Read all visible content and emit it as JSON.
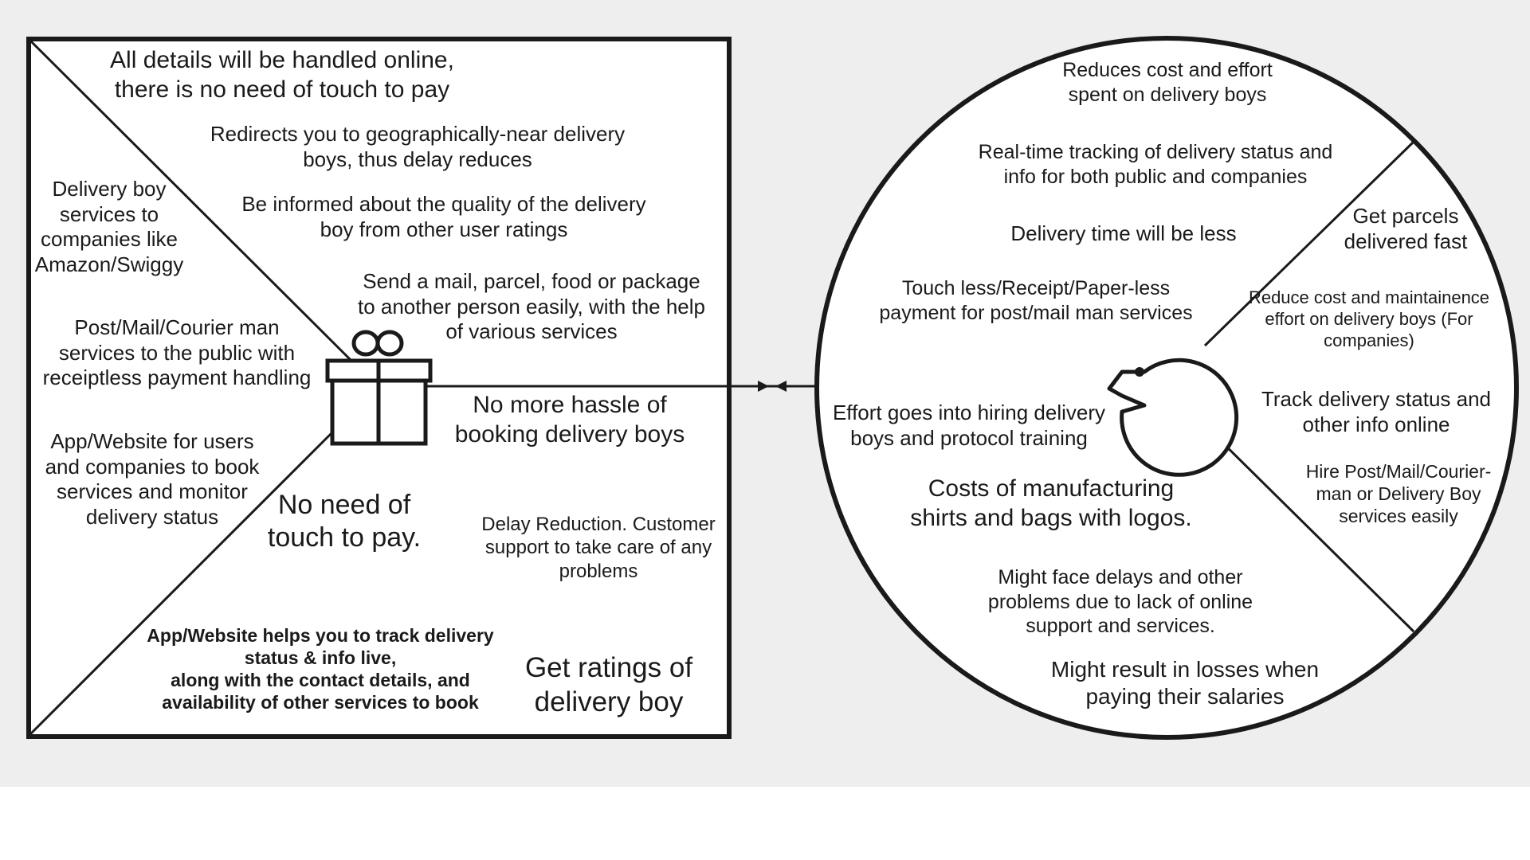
{
  "colors": {
    "canvas_background": "#eeeeee",
    "page_background": "#ffffff",
    "ink": "#1a1a1a",
    "shape_fill": "#ffffff"
  },
  "icons": {
    "product": "gift-icon",
    "customer": "face-icon",
    "connector": "double-arrow-icon"
  },
  "product_square": {
    "top_section": [
      "All details will be handled online,\nthere is no need of touch to pay",
      "Redirects you to geographically-near delivery\nboys, thus delay reduces",
      "Be informed about the quality of the delivery\nboy from other user ratings",
      "Send a mail, parcel, food or package\nto another person easily, with the help\nof various services",
      "No more hassle of\nbooking delivery boys"
    ],
    "left_section": [
      "Delivery boy\nservices to\ncompanies like\nAmazon/Swiggy",
      "Post/Mail/Courier man\nservices to the public with\nreceiptless payment handling",
      "App/Website for users\nand companies to book\nservices and monitor\ndelivery status"
    ],
    "bottom_section": [
      "No need of\ntouch to pay.",
      "Delay Reduction. Customer\nsupport to take care of any\nproblems",
      "App/Website helps you to track delivery\nstatus & info live,\nalong with the contact details, and\navailability of other services to book",
      "Get ratings of\ndelivery boy"
    ]
  },
  "customer_circle": {
    "top_section": [
      "Reduces cost and effort\nspent on delivery boys",
      "Real-time tracking of delivery status and\ninfo for both public and companies",
      "Delivery time will be less",
      "Touch less/Receipt/Paper-less\npayment for post/mail man services"
    ],
    "right_section": [
      "Get parcels\ndelivered fast",
      "Reduce cost and maintainence\neffort on delivery boys (For\ncompanies)",
      "Track delivery status and\nother info online",
      "Hire Post/Mail/Courier-\nman or Delivery Boy\nservices easily"
    ],
    "bottom_section": [
      "Effort goes into hiring delivery\nboys and protocol training",
      "Costs of manufacturing\nshirts and bags with logos.",
      "Might face delays and other\nproblems due to lack of online\nsupport and services.",
      "Might result in losses when\npaying their salaries"
    ]
  }
}
